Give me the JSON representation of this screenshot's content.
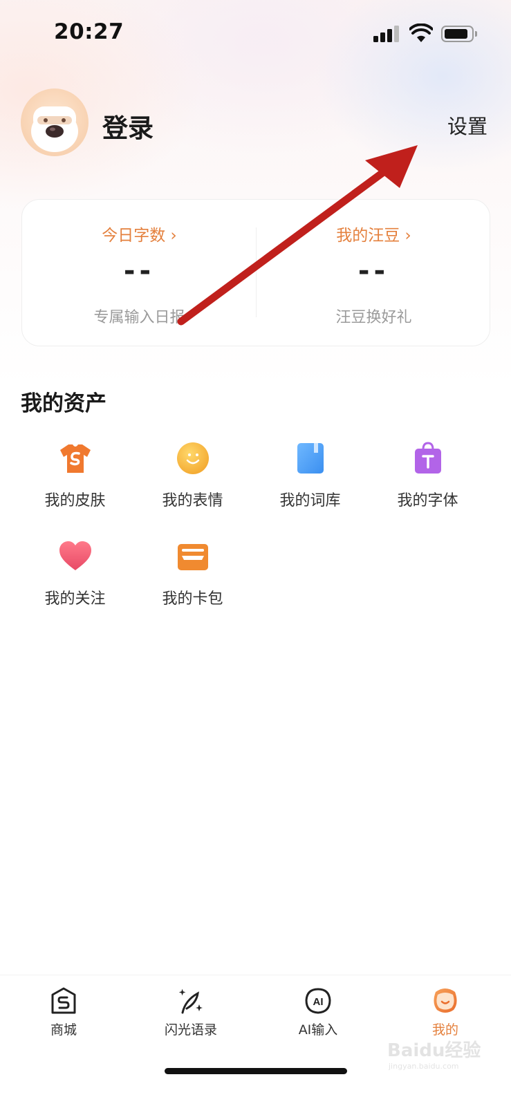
{
  "status_bar": {
    "time": "20:27"
  },
  "profile": {
    "login_label": "登录",
    "settings_label": "设置"
  },
  "stats": [
    {
      "title": "今日字数 ›",
      "value": "--",
      "subtitle": "专属输入日报"
    },
    {
      "title": "我的汪豆 ›",
      "value": "--",
      "subtitle": "汪豆换好礼"
    }
  ],
  "assets": {
    "title": "我的资产",
    "items": [
      {
        "label": "我的皮肤",
        "icon": "tshirt-icon"
      },
      {
        "label": "我的表情",
        "icon": "smiley-icon"
      },
      {
        "label": "我的词库",
        "icon": "book-icon"
      },
      {
        "label": "我的字体",
        "icon": "font-bag-icon"
      },
      {
        "label": "我的关注",
        "icon": "heart-icon"
      },
      {
        "label": "我的卡包",
        "icon": "card-wallet-icon"
      }
    ]
  },
  "tabbar": {
    "tabs": [
      {
        "label": "商城",
        "icon": "store-icon",
        "active": false
      },
      {
        "label": "闪光语录",
        "icon": "feather-sparkle-icon",
        "active": false
      },
      {
        "label": "AI输入",
        "icon": "ai-icon",
        "active": false
      },
      {
        "label": "我的",
        "icon": "profile-face-icon",
        "active": true
      }
    ]
  },
  "watermark": {
    "text": "Baidu经验",
    "subtext": "jingyan.baidu.com"
  },
  "colors": {
    "accent": "#e4803d",
    "arrow": "#c0201c"
  }
}
